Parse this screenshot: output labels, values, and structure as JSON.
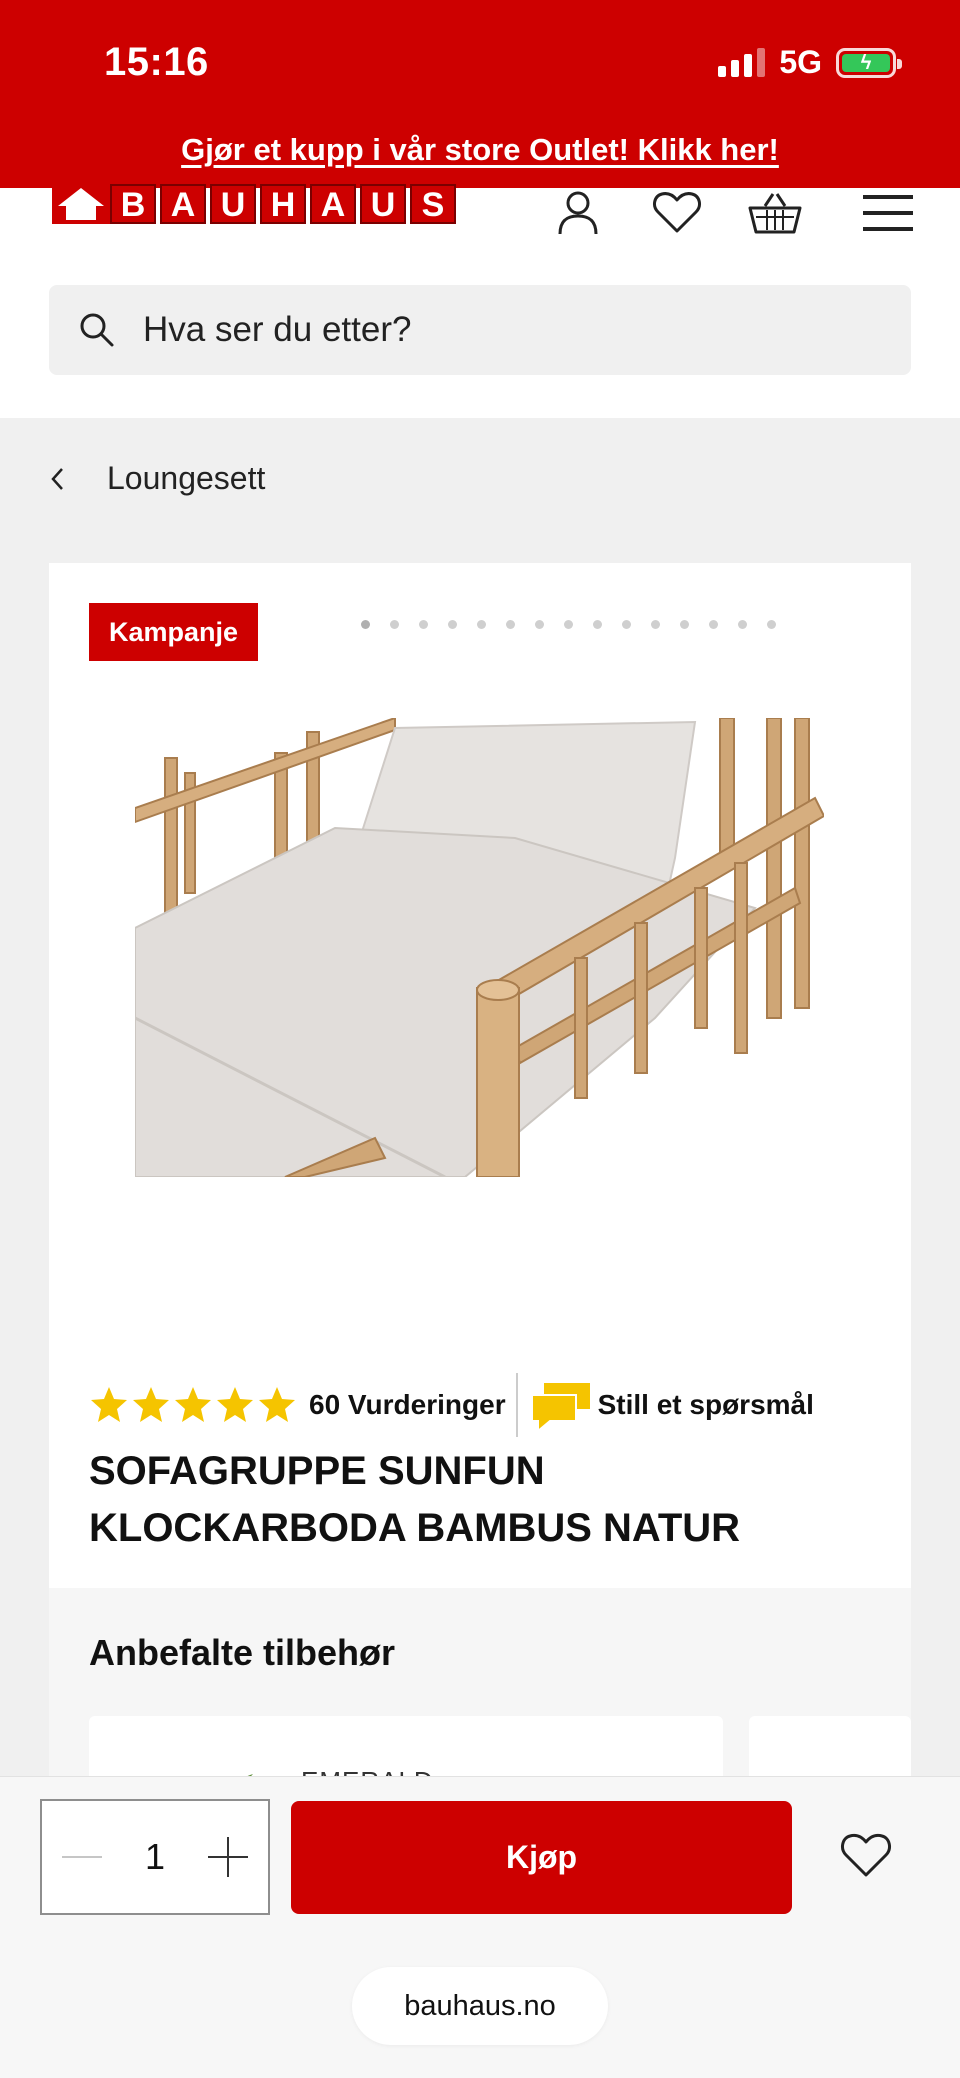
{
  "status_bar": {
    "time": "15:16",
    "network": "5G",
    "battery_icon": "battery-charging-icon",
    "battery_color": "#34c759"
  },
  "promo": {
    "text": "Gjør et kupp i vår store Outlet! Klikk her!"
  },
  "brand": {
    "logo_text": "BAUHAUS",
    "accent_color": "#cd0000"
  },
  "header": {
    "icons": [
      "user-icon",
      "heart-icon",
      "basket-icon",
      "menu-icon"
    ]
  },
  "search": {
    "placeholder": "Hva ser du etter?"
  },
  "breadcrumb": {
    "label": "Loungesett"
  },
  "product": {
    "badge": "Kampanje",
    "image_count": 15,
    "active_image": 1,
    "rating_stars": 5,
    "rating_count_label": "60 Vurderinger",
    "ask_label": "Still et spørsmål",
    "title": "SOFAGRUPPE SUNFUN KLOCKARBODA BAMBUS NATUR"
  },
  "accessories": {
    "title": "Anbefalte tilbehør",
    "first_item_brand": "EMERALD"
  },
  "purchase": {
    "quantity": "1",
    "buy_label": "Kjøp"
  },
  "browser": {
    "url": "bauhaus.no"
  }
}
